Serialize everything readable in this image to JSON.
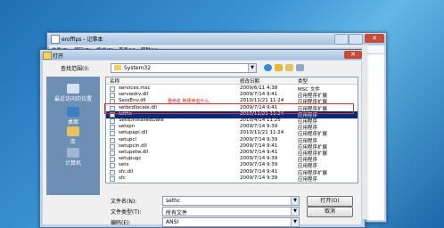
{
  "notepad": {
    "title": "eroffips - 记事本",
    "menu": [
      "文件(F)",
      "编辑(E)",
      "格式(O)",
      "查看(V)",
      "帮助(H)"
    ]
  },
  "dialog": {
    "title": "打开",
    "look_in_label": "查找范围(I):",
    "look_in_value": "System32",
    "places": [
      {
        "label": "最近访问的位置",
        "icon": "recent-icon"
      },
      {
        "label": "桌面",
        "icon": "desktop-icon"
      },
      {
        "label": "库",
        "icon": "library-icon"
      },
      {
        "label": "计算机",
        "icon": "computer-icon"
      }
    ],
    "columns": {
      "name": "名称",
      "date": "修改日期",
      "type": "类型"
    },
    "files": [
      {
        "name": "services.msc",
        "date": "2009/6/11 4:38",
        "type": "MSC 文件"
      },
      {
        "name": "servwdrv.dll",
        "date": "2009/7/14 9:41",
        "type": "应用程序扩展"
      },
      {
        "name": "SessEnv.dll",
        "date": "2010/11/21 11:24",
        "type": "应用程序扩展"
      },
      {
        "name": "setbcdlocale.dll",
        "date": "2009/7/14 9:41",
        "type": "应用程序扩展"
      },
      {
        "name": "sethc",
        "date": "2010/11/21 11:24",
        "type": "应用程序"
      },
      {
        "name": "SetIEInstalledDate",
        "date": "2010/4/14 11:25",
        "type": "应用程序"
      },
      {
        "name": "setspn",
        "date": "2009/7/14 9:39",
        "type": "应用程序"
      },
      {
        "name": "setupapi.dll",
        "date": "2010/11/21 11:24",
        "type": "应用程序扩展"
      },
      {
        "name": "setupcl",
        "date": "2009/7/14 9:39",
        "type": "应用程序"
      },
      {
        "name": "setupcln.dll",
        "date": "2009/7/14 9:41",
        "type": "应用程序扩展"
      },
      {
        "name": "setupetw.dll",
        "date": "2009/7/14 9:41",
        "type": "应用程序扩展"
      },
      {
        "name": "setupugc",
        "date": "2009/7/14 9:39",
        "type": "应用程序"
      },
      {
        "name": "setx",
        "date": "2009/7/14 9:39",
        "type": "应用程序"
      },
      {
        "name": "sfc.dll",
        "date": "2009/7/14 9:41",
        "type": "应用程序扩展"
      },
      {
        "name": "sfc",
        "date": "2009/7/14 9:39",
        "type": "应用程序"
      }
    ],
    "annotation": "重命名   随便命名什么",
    "filename_label": "文件名(N):",
    "filename_value": "sethc",
    "filetype_label": "文件类型(T):",
    "filetype_value": "所有文件",
    "encoding_label": "编码(E):",
    "encoding_value": "ANSI",
    "open_button": "打开(O)",
    "cancel_button": "取消"
  },
  "colors": {
    "selection": "#0a2a7a",
    "annotation": "#e03030"
  }
}
